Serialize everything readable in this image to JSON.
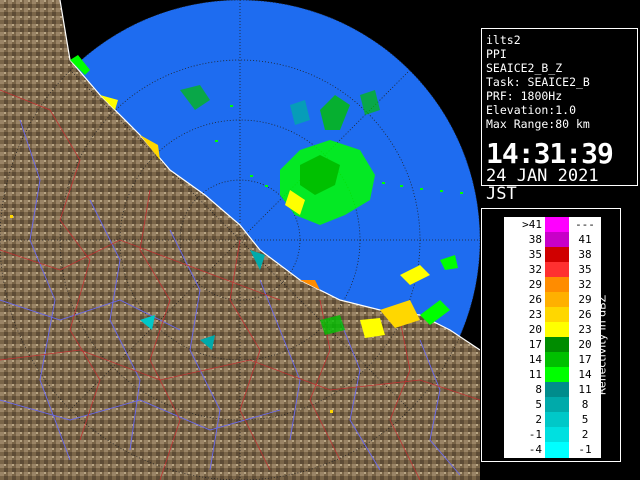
{
  "radar": {
    "station": "ilts2",
    "product": "PPI",
    "scan": "SEAICE2_B_Z",
    "task": "Task: SEAICE2_B",
    "prf": "PRF: 1800Hz",
    "elevation": "Elevation:1.0",
    "max_range": "Max Range:80 km",
    "time": "14:31:39",
    "date": "24 JAN 2021 JST"
  },
  "legend": {
    "unit_label": "Reflectivity in dBZ",
    "rows": [
      {
        "min": ">41",
        "max": "---",
        "color": "#ff00ff"
      },
      {
        "min": "38",
        "max": "41",
        "color": "#c800c8"
      },
      {
        "min": "35",
        "max": "38",
        "color": "#d00000"
      },
      {
        "min": "32",
        "max": "35",
        "color": "#ff3030"
      },
      {
        "min": "29",
        "max": "32",
        "color": "#ff8c00"
      },
      {
        "min": "26",
        "max": "29",
        "color": "#ffb000"
      },
      {
        "min": "23",
        "max": "26",
        "color": "#ffd700"
      },
      {
        "min": "20",
        "max": "23",
        "color": "#ffff00"
      },
      {
        "min": "17",
        "max": "20",
        "color": "#008c00"
      },
      {
        "min": "14",
        "max": "17",
        "color": "#00c000"
      },
      {
        "min": "11",
        "max": "14",
        "color": "#00ff00"
      },
      {
        "min": "8",
        "max": "11",
        "color": "#008c8c"
      },
      {
        "min": "5",
        "max": "8",
        "color": "#00aaaa"
      },
      {
        "min": "2",
        "max": "5",
        "color": "#00c8c8"
      },
      {
        "min": "-1",
        "max": "2",
        "color": "#00e0e0"
      },
      {
        "min": "-4",
        "max": "-1",
        "color": "#00ffff"
      }
    ]
  },
  "map": {
    "sea_color": "#1e6cf0",
    "land_color": "#8b7355",
    "out_of_range_color": "#000000",
    "icons": [
      "range-ring",
      "coastline",
      "river",
      "echo-cluster"
    ]
  }
}
